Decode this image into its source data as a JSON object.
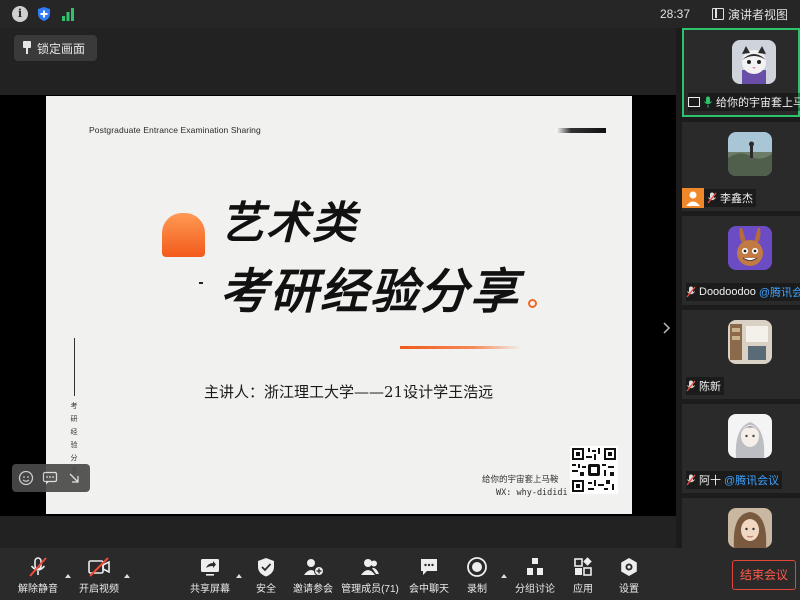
{
  "status_bar": {
    "timer": "28:37",
    "view_mode": "演讲者视图"
  },
  "main_view": {
    "lock_label": "锁定画面"
  },
  "slide": {
    "header": "Postgraduate Entrance Examination Sharing",
    "title_line1": "艺术类",
    "title_line2": "考研经验分享",
    "speaker": "主讲人：浙江理工大学——21设计学王浩远",
    "vertical_text": "考研经验分享",
    "wechat_credit": "给你的宇宙套上马鞍",
    "wechat_id": "WX: why-dididi"
  },
  "participants": [
    {
      "name": "给你的宇宙套上马鞍",
      "suffix": "",
      "active": true,
      "sharing": true,
      "mic": "on",
      "avatar": "cat-avatar"
    },
    {
      "name": "李鑫杰",
      "suffix": "",
      "active": false,
      "sharing": false,
      "mic": "muted",
      "avatar": "landscape-avatar"
    },
    {
      "name": "Doodoodoo",
      "suffix": "@腾讯会议",
      "active": false,
      "sharing": false,
      "mic": "muted",
      "avatar": "bunny-avatar"
    },
    {
      "name": "陈新",
      "suffix": "",
      "active": false,
      "sharing": false,
      "mic": "muted",
      "avatar": "room-avatar"
    },
    {
      "name": "阿十",
      "suffix": "@腾讯会议",
      "active": false,
      "sharing": false,
      "mic": "muted",
      "avatar": "anime-avatar"
    },
    {
      "name": "",
      "suffix": "",
      "active": false,
      "sharing": false,
      "mic": "",
      "avatar": "portrait-avatar"
    }
  ],
  "toolbar": {
    "unmute": "解除静音",
    "start_video": "开启视频",
    "share_screen": "共享屏幕",
    "security": "安全",
    "invite": "邀请参会",
    "manage_members": "管理成员(71)",
    "chat": "会中聊天",
    "record": "录制",
    "breakout": "分组讨论",
    "apps": "应用",
    "settings": "设置",
    "end_meeting": "结束会议"
  },
  "colors": {
    "accent_orange": "#f25a1a",
    "end_red": "#e0483a",
    "active_green": "#2dc26b",
    "brand_blue": "#3fa2ff"
  }
}
